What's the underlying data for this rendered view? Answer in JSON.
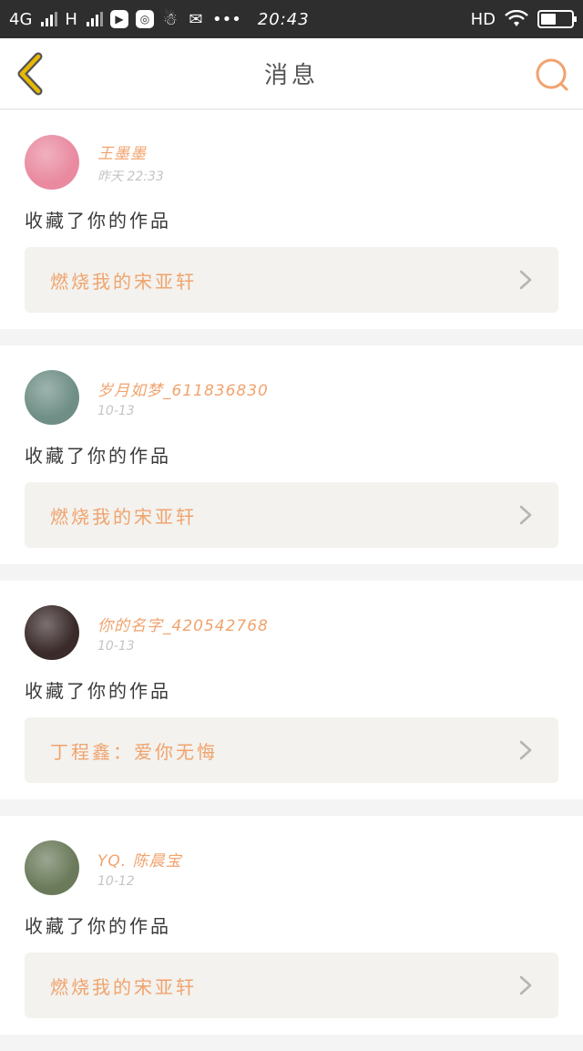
{
  "status_bar": {
    "network1": "4G",
    "network2": "H",
    "time": "20:43",
    "hd": "HD",
    "more": "•••",
    "battery_level": 0.5,
    "apps": [
      "play-icon",
      "browser-icon",
      "qq-icon",
      "wechat-icon"
    ]
  },
  "nav": {
    "title": "消息",
    "accent_color": "#f0a36e",
    "back_color": "#e8b800"
  },
  "messages": [
    {
      "name": "王墨墨",
      "time": "昨天 22:33",
      "action": "收藏了你的作品",
      "work": "燃烧我的宋亚轩",
      "avatar_color": "#e98aa0"
    },
    {
      "name": "岁月如梦_611836830",
      "time": "10-13",
      "action": "收藏了你的作品",
      "work": "燃烧我的宋亚轩",
      "avatar_color": "#6f8f86"
    },
    {
      "name": "你的名字_420542768",
      "time": "10-13",
      "action": "收藏了你的作品",
      "work": "丁程鑫：爱你无悔",
      "avatar_color": "#3a2a2a"
    },
    {
      "name": "YQ. 陈晨宝",
      "time": "10-12",
      "action": "收藏了你的作品",
      "work": "燃烧我的宋亚轩",
      "avatar_color": "#6a7a5a"
    }
  ]
}
